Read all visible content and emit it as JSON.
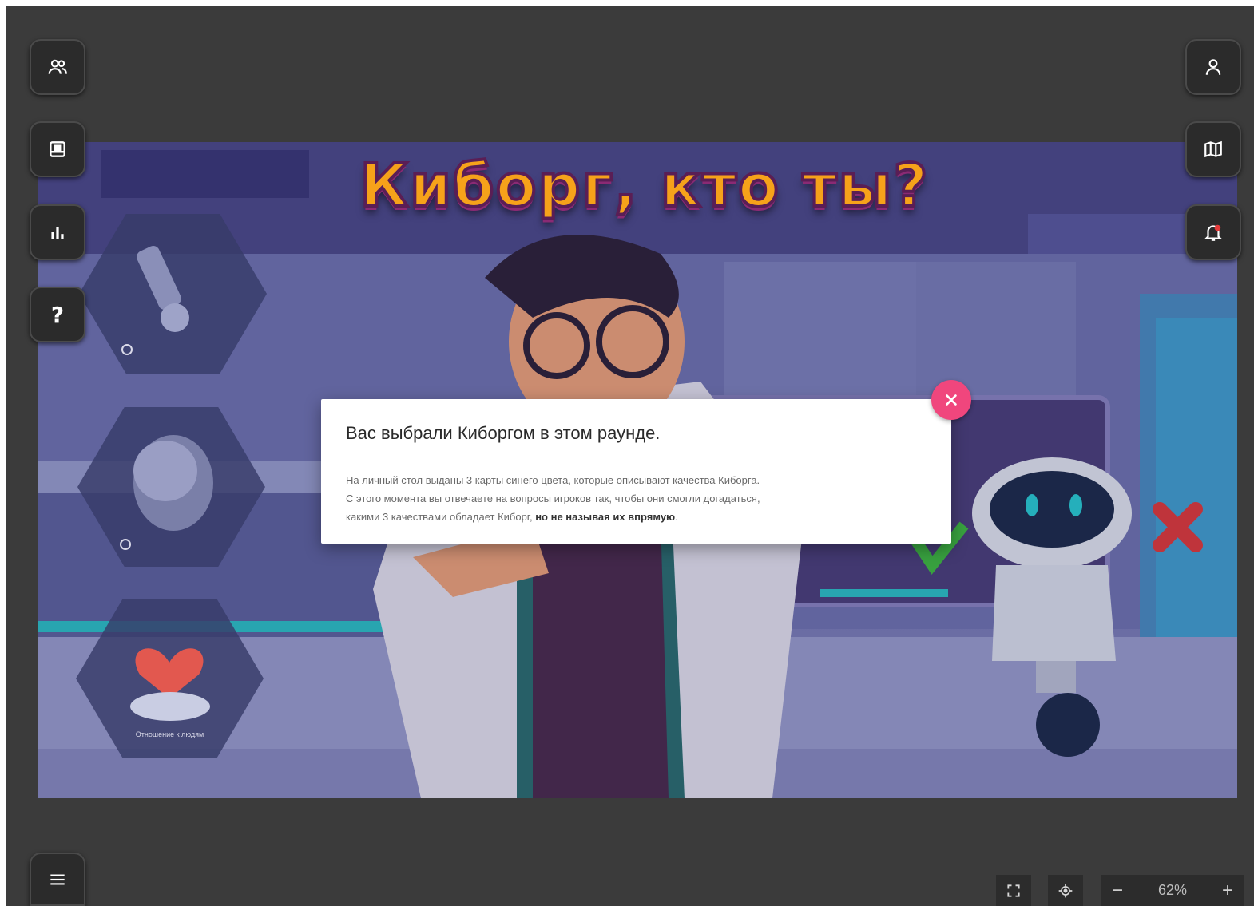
{
  "game": {
    "title": "Киборг, кто ты?",
    "hex_cards": [
      {
        "label": ""
      },
      {
        "label": ""
      },
      {
        "label": "Отношение к людям"
      }
    ]
  },
  "modal": {
    "title": "Вас выбрали Киборгом в этом раунде.",
    "body_line1": "На личный стол выданы 3 карты синего цвета, которые описывают качества Киборга.",
    "body_line2": "С этого момента вы отвечаете на вопросы игроков так, чтобы они смогли догадаться,",
    "body_line3_plain": "какими 3 качествами обладает Киборг, ",
    "body_line3_bold": "но не называя их впрямую",
    "body_line3_end": "."
  },
  "left_toolbar": {
    "items": [
      {
        "icon": "players-icon"
      },
      {
        "icon": "card-deck-icon"
      },
      {
        "icon": "stats-icon"
      },
      {
        "icon": "help-icon",
        "glyph": "?"
      }
    ]
  },
  "right_toolbar": {
    "items": [
      {
        "icon": "profile-icon"
      },
      {
        "icon": "map-icon"
      },
      {
        "icon": "notifications-icon",
        "has_alert": true
      }
    ]
  },
  "bottom": {
    "menu_icon": "hamburger-menu-icon",
    "fullscreen_icon": "fullscreen-icon",
    "center_icon": "crosshair-icon",
    "zoom": {
      "minus": "−",
      "value": "62%",
      "plus": "+"
    }
  },
  "colors": {
    "accent_close": "#f0467d",
    "panel_bg": "#3b3b3b",
    "button_bg": "#2b2b2b",
    "title_fill": "#f6a21a"
  }
}
